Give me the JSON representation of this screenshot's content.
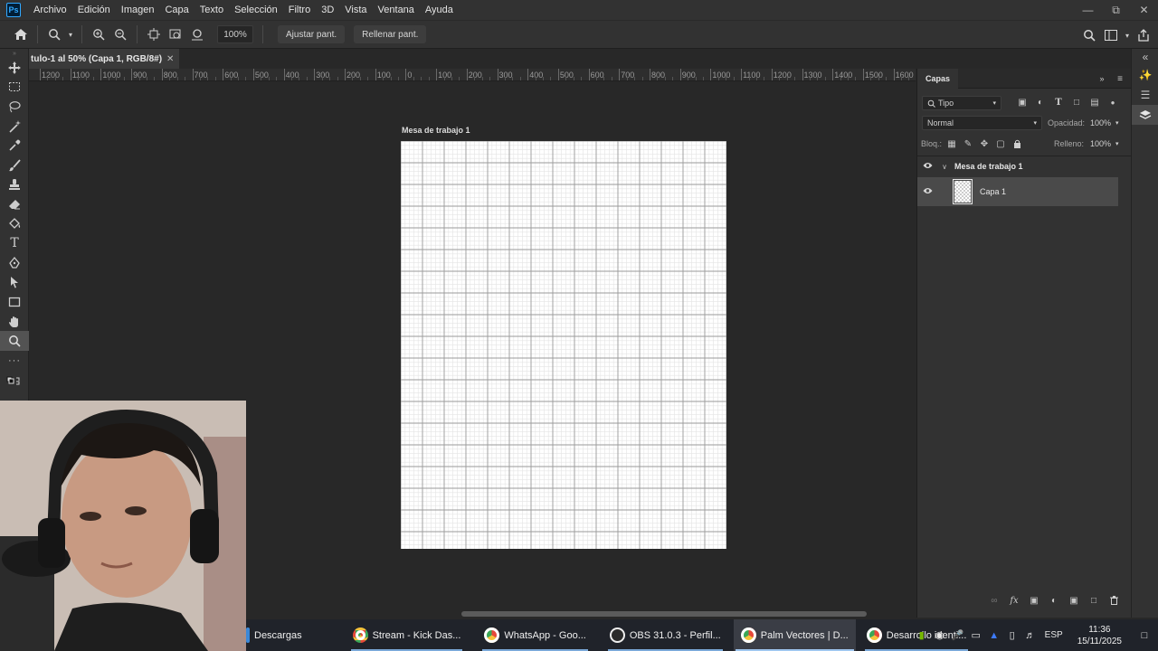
{
  "menubar": {
    "logo": "Ps",
    "items": [
      "Archivo",
      "Edición",
      "Imagen",
      "Capa",
      "Texto",
      "Selección",
      "Filtro",
      "3D",
      "Vista",
      "Ventana",
      "Ayuda"
    ]
  },
  "options_bar": {
    "zoom_value": "100%",
    "fit_screen_label": "Ajustar pant.",
    "fill_screen_label": "Rellenar pant."
  },
  "document": {
    "tab_title": "tulo-1 al 50% (Capa 1, RGB/8#)",
    "artboard_label": "Mesa de trabajo 1"
  },
  "ruler": {
    "labels": [
      "1200",
      "1100",
      "1000",
      "900",
      "800",
      "700",
      "600",
      "500",
      "400",
      "300",
      "200",
      "100",
      "0",
      "100",
      "200",
      "300",
      "400",
      "500",
      "600",
      "700",
      "800",
      "900",
      "1000",
      "1100",
      "1200",
      "1300",
      "1400",
      "1500",
      "1600"
    ]
  },
  "layers_panel": {
    "tab_title": "Capas",
    "filter_label": "Tipo",
    "blend_mode": "Normal",
    "opacity_label": "Opacidad:",
    "opacity_value": "100%",
    "lock_label": "Bloq.:",
    "fill_label": "Relleno:",
    "fill_value": "100%",
    "layers": [
      {
        "name": "Mesa de trabajo 1",
        "type": "artboard"
      },
      {
        "name": "Capa 1",
        "type": "layer",
        "selected": true
      }
    ]
  },
  "taskbar": {
    "apps": [
      {
        "label": "Descargas",
        "icon": "folder-icon",
        "color": "#f0c23a"
      },
      {
        "label": "Stream - Kick Das...",
        "icon": "chrome-icon",
        "color": "#e6493a"
      },
      {
        "label": "WhatsApp - Goo...",
        "icon": "chrome-icon",
        "color": "#e6493a"
      },
      {
        "label": "OBS 31.0.3 - Perfil...",
        "icon": "obs-icon",
        "color": "#2b2b2b"
      },
      {
        "label": "Palm Vectores | D...",
        "icon": "chrome-icon",
        "color": "#e6493a",
        "active": true
      },
      {
        "label": "Desarrollo identi...",
        "icon": "chrome-icon",
        "color": "#e6493a"
      }
    ],
    "language": "ESP",
    "time": "11:36",
    "date": "15/11/2025"
  }
}
